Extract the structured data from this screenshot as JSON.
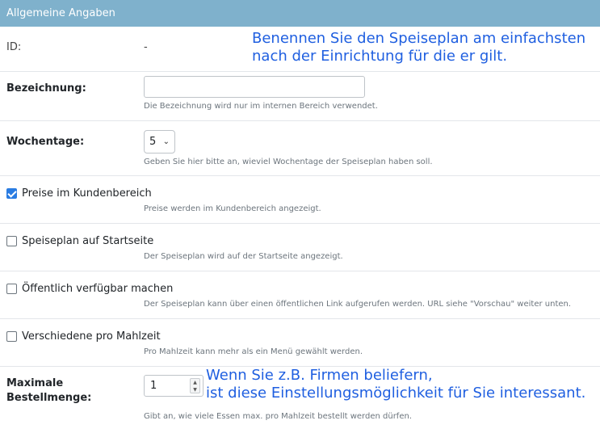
{
  "header": {
    "title": "Allgemeine Angaben"
  },
  "fields": {
    "id": {
      "label": "ID:",
      "value": "-"
    },
    "bezeichnung": {
      "label": "Bezeichnung:",
      "value": "",
      "help": "Die Bezeichnung wird nur im internen Bereich verwendet."
    },
    "wochentage": {
      "label": "Wochentage:",
      "selected": "5",
      "help": "Geben Sie hier bitte an, wieviel Wochentage der Speiseplan haben soll."
    },
    "preise": {
      "label": "Preise im Kundenbereich",
      "checked": true,
      "help": "Preise werden im Kundenbereich angezeigt."
    },
    "startseite": {
      "label": "Speiseplan auf Startseite",
      "checked": false,
      "help": "Der Speiseplan wird auf der Startseite angezeigt."
    },
    "oeffentlich": {
      "label": "Öffentlich verfügbar machen",
      "checked": false,
      "help": "Der Speiseplan kann über einen öffentlichen Link aufgerufen werden. URL siehe \"Vorschau\" weiter unten."
    },
    "mahlzeit": {
      "label": "Verschiedene pro Mahlzeit",
      "checked": false,
      "help": "Pro Mahlzeit kann mehr als ein Menü gewählt werden."
    },
    "bestellmenge": {
      "label_line1": "Maximale",
      "label_line2": "Bestellmenge:",
      "value": "1",
      "help": "Gibt an, wie viele Essen max. pro Mahlzeit bestellt werden dürfen."
    }
  },
  "annotations": {
    "top_line1": "Benennen Sie den Speiseplan am einfachsten",
    "top_line2": "nach der Einrichtung für die er gilt.",
    "bottom_line1": "Wenn Sie z.B. Firmen beliefern,",
    "bottom_line2": "ist diese Einstellungsmöglichkeit für Sie interessant."
  },
  "colors": {
    "header_bg": "#7fb1cc",
    "annotation_text": "#1f5fe0",
    "checkbox_checked": "#2a7ce2"
  }
}
